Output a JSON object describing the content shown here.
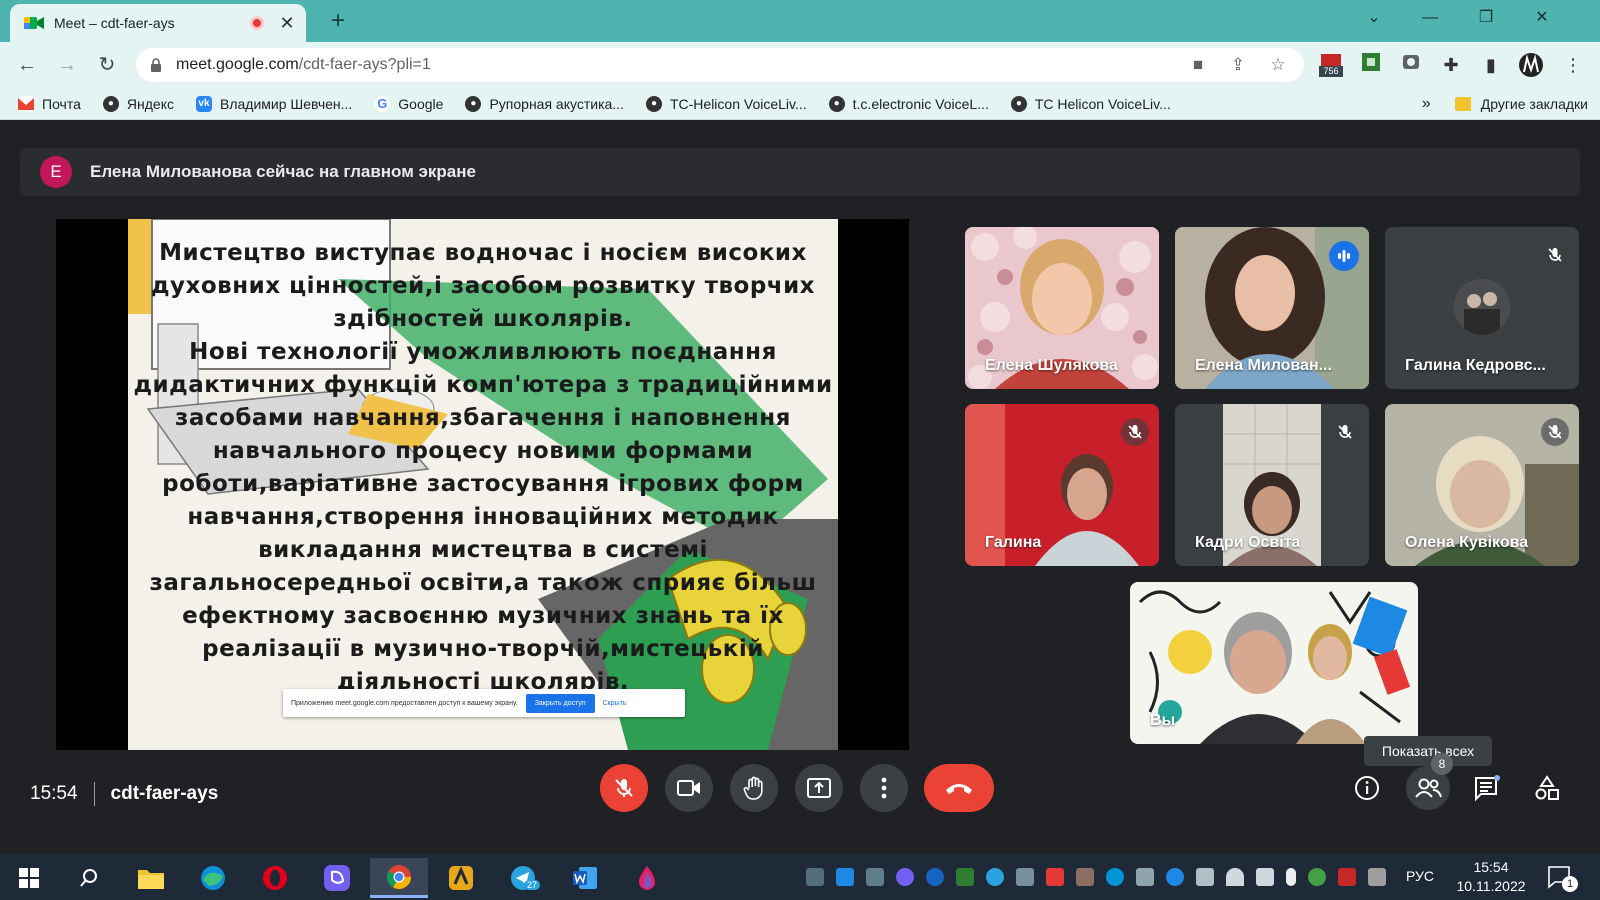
{
  "browser": {
    "tab_title": "Meet – cdt-faer-ays",
    "url_host": "meet.google.com",
    "url_path": "/cdt-faer-ays?pli=1",
    "extension_badge": "756",
    "bookmarks": [
      {
        "label": "Почта",
        "icon": "gmail-icon",
        "color": "#ea4335"
      },
      {
        "label": "Яндекс",
        "icon": "globe-icon",
        "color": "#333333"
      },
      {
        "label": "Владимир Шевчен...",
        "icon": "vk-icon",
        "color": "#2787f5"
      },
      {
        "label": "Google",
        "icon": "google-icon",
        "color": "#4285f4"
      },
      {
        "label": "Рупорная акустика...",
        "icon": "globe-icon",
        "color": "#333333"
      },
      {
        "label": "TC-Helicon VoiceLiv...",
        "icon": "globe-icon",
        "color": "#333333"
      },
      {
        "label": "t.c.electronic VoiceL...",
        "icon": "globe-icon",
        "color": "#333333"
      },
      {
        "label": "TC Helicon VoiceLiv...",
        "icon": "globe-icon",
        "color": "#333333"
      }
    ],
    "bookmarks_more": "»",
    "other_bookmarks": "Другие закладки"
  },
  "meet": {
    "presenter_initial": "E",
    "presenter_notice": "Елена Милованова сейчас на главном экране",
    "slide_text": "Мистецтво виступає водночас і носієм високих\nдуховних цінностей,і засобом розвитку творчих\nздібностей школярів.\nНові технології уможливлюють поєднання\nдидактичних функцій комп'ютера з традиційними\nзасобами навчання,збагачення і наповнення\nнавчального процесу новими формами\nроботи,варіативне застосування ігрових форм\nнавчання,створення інноваційних методик\nвикладання мистецтва в системі\nзагальносередньої освіти,а також сприяє більш\nефектному засвоєнню музичних знань та їх\nреалізації в музично-творчій,мистецькій\nдіяльності школярів.",
    "share_banner": {
      "text": "Приложению meet.google.com предоставлен доступ к вашему экрану.",
      "stop": "Закрыть доступ",
      "hide": "Скрыть"
    },
    "participants": [
      {
        "name": "Елена Шулякова",
        "muted": false,
        "speaking": false
      },
      {
        "name": "Елена Милован...",
        "muted": false,
        "speaking": true
      },
      {
        "name": "Галина Кедровс...",
        "muted": true,
        "speaking": false
      },
      {
        "name": "Галина",
        "muted": true,
        "speaking": false
      },
      {
        "name": "Кадри Освіта",
        "muted": true,
        "speaking": false
      },
      {
        "name": "Олена Кувікова",
        "muted": true,
        "speaking": false
      }
    ],
    "self_tile_name": "Вы",
    "tooltip": "Показать всех",
    "time": "15:54",
    "meeting_code": "cdt-faer-ays",
    "people_count": "8",
    "colors": {
      "accent": "#8ab4f8",
      "danger": "#ea4335",
      "control_bg": "#3c4043"
    }
  },
  "taskbar": {
    "language": "РУС",
    "clock_time": "15:54",
    "clock_date": "10.11.2022",
    "telegram_badge": "27",
    "notification_count": "1"
  }
}
